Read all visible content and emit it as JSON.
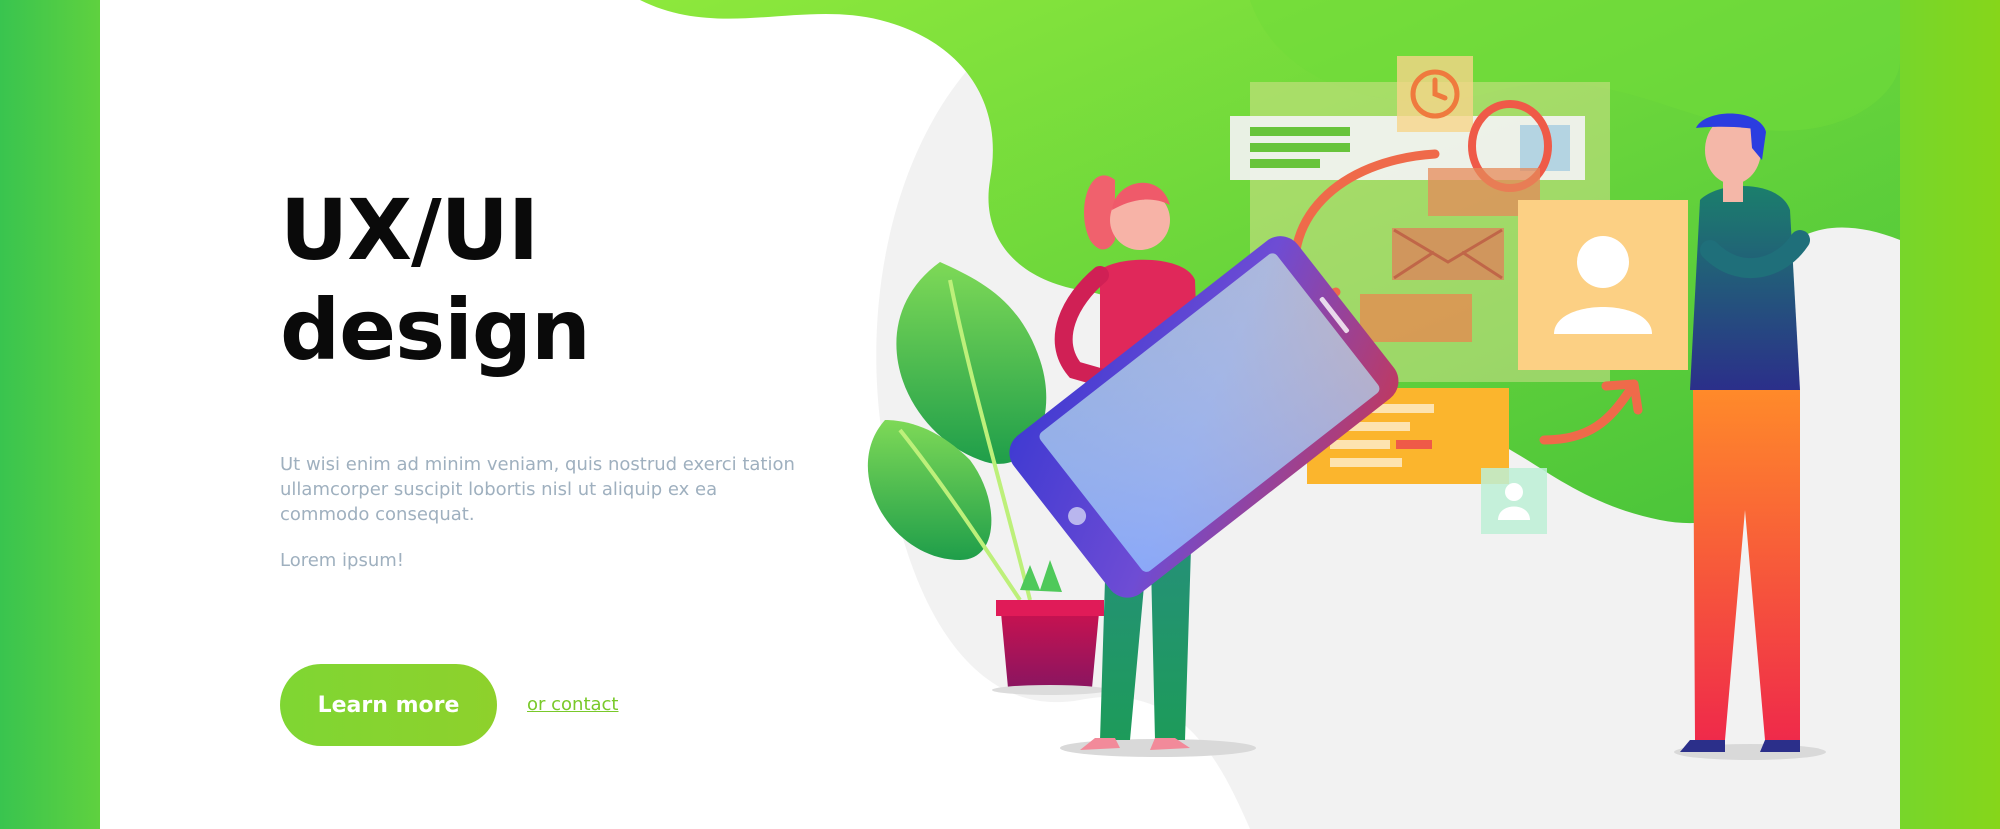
{
  "hero": {
    "title_line1": "UX/UI",
    "title_line2": "design",
    "description": "Ut wisi enim ad minim veniam, quis nostrud exerci tation ullamcorper suscipit lobortis nisl ut aliquip ex ea commodo consequat.",
    "subtext": "Lorem ipsum!",
    "cta_label": "Learn more",
    "contact_label": "or contact"
  },
  "colors": {
    "brand_green": "#7fd633",
    "heading": "#0a0a0a",
    "muted_text": "#9fb0bf",
    "accent_orange": "#f3b43a",
    "accent_red": "#ef5a48"
  },
  "illustration": {
    "subject": "ux-ui-design-team",
    "icons": [
      "clock-icon",
      "user-profile-icon",
      "email-icon",
      "plant-icon",
      "smartphone-icon"
    ]
  }
}
